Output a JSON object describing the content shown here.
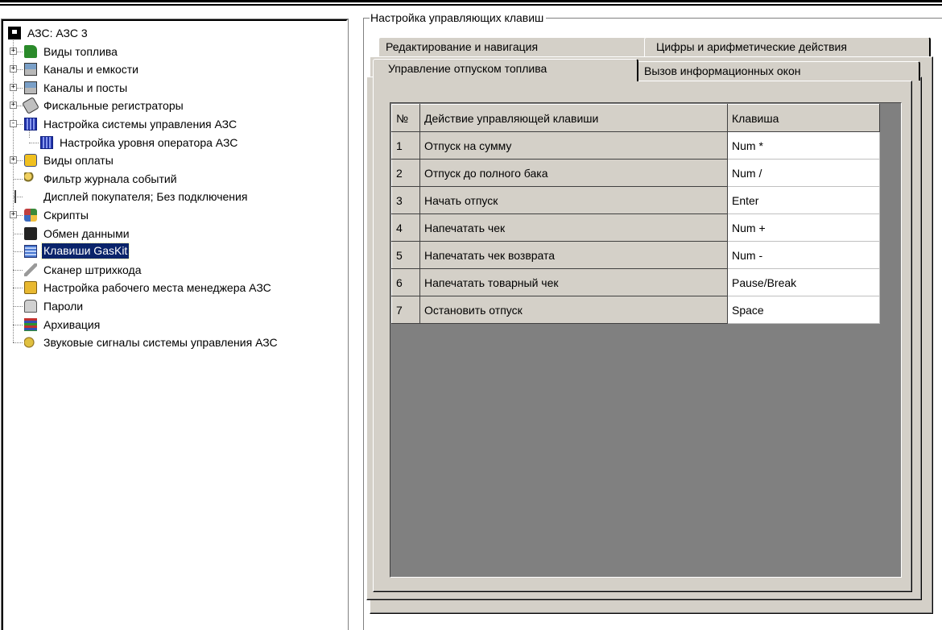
{
  "tree": {
    "items": [
      {
        "label": "АЗС: АЗС 3",
        "icon": "station-icon",
        "level": 0,
        "expander": null,
        "selected": false
      },
      {
        "label": "Виды топлива",
        "icon": "fuel-pump-icon",
        "level": 1,
        "expander": "+",
        "selected": false
      },
      {
        "label": "Каналы и емкости",
        "icon": "channels-tanks-icon",
        "level": 1,
        "expander": "+",
        "selected": false
      },
      {
        "label": "Каналы и посты",
        "icon": "channels-posts-icon",
        "level": 1,
        "expander": "+",
        "selected": false
      },
      {
        "label": "Фискальные регистраторы",
        "icon": "fiscal-register-icon",
        "level": 1,
        "expander": "+",
        "selected": false
      },
      {
        "label": "Настройка системы управления АЗС",
        "icon": "control-system-icon",
        "level": 1,
        "expander": "-",
        "selected": false
      },
      {
        "label": "Настройка уровня оператора АЗС",
        "icon": "operator-level-icon",
        "level": 2,
        "expander": null,
        "selected": false
      },
      {
        "label": "Виды оплаты",
        "icon": "payment-types-icon",
        "level": 1,
        "expander": "+",
        "selected": false
      },
      {
        "label": "Фильтр журнала событий",
        "icon": "event-log-filter-icon",
        "level": 1,
        "expander": null,
        "selected": false
      },
      {
        "label": "Дисплей покупателя; Без подключения",
        "icon": "customer-display-icon",
        "level": 1,
        "expander": null,
        "selected": false
      },
      {
        "label": "Скрипты",
        "icon": "scripts-icon",
        "level": 1,
        "expander": "+",
        "selected": false
      },
      {
        "label": "Обмен данными",
        "icon": "data-exchange-icon",
        "level": 1,
        "expander": null,
        "selected": false
      },
      {
        "label": "Клавиши GasKit",
        "icon": "gaskit-keys-icon",
        "level": 1,
        "expander": null,
        "selected": true
      },
      {
        "label": "Сканер штрихкода",
        "icon": "barcode-scanner-icon",
        "level": 1,
        "expander": null,
        "selected": false
      },
      {
        "label": "Настройка рабочего места менеджера АЗС",
        "icon": "manager-workplace-icon",
        "level": 1,
        "expander": null,
        "selected": false
      },
      {
        "label": "Пароли",
        "icon": "passwords-icon",
        "level": 1,
        "expander": null,
        "selected": false
      },
      {
        "label": "Архивация",
        "icon": "archive-icon",
        "level": 1,
        "expander": null,
        "selected": false
      },
      {
        "label": "Звуковые сигналы системы управления АЗС",
        "icon": "sound-signals-icon",
        "level": 1,
        "expander": null,
        "selected": false
      }
    ]
  },
  "group": {
    "title": "Настройка управляющих клавиш"
  },
  "tabs": {
    "row_back": [
      "Редактирование и навигация",
      "Цифры и арифметические действия"
    ],
    "row_front": [
      "Управление отпуском топлива",
      "Вызов информационных окон"
    ],
    "active": "Управление отпуском топлива"
  },
  "grid": {
    "columns": [
      "№",
      "Действие управляющей клавиши",
      "Клавиша"
    ],
    "rows": [
      {
        "num": "1",
        "action": "Отпуск на сумму",
        "key": "Num *"
      },
      {
        "num": "2",
        "action": "Отпуск до полного бака",
        "key": "Num /"
      },
      {
        "num": "3",
        "action": "Начать отпуск",
        "key": "Enter"
      },
      {
        "num": "4",
        "action": "Напечатать чек",
        "key": "Num +"
      },
      {
        "num": "5",
        "action": "Напечатать чек возврата",
        "key": "Num -"
      },
      {
        "num": "6",
        "action": "Напечатать товарный чек",
        "key": "Pause/Break"
      },
      {
        "num": "7",
        "action": "Остановить отпуск",
        "key": "Space"
      }
    ]
  },
  "colors": {
    "window_bg": "#d4d0c8",
    "grid_bg": "#808080",
    "selection": "#0a246a"
  }
}
